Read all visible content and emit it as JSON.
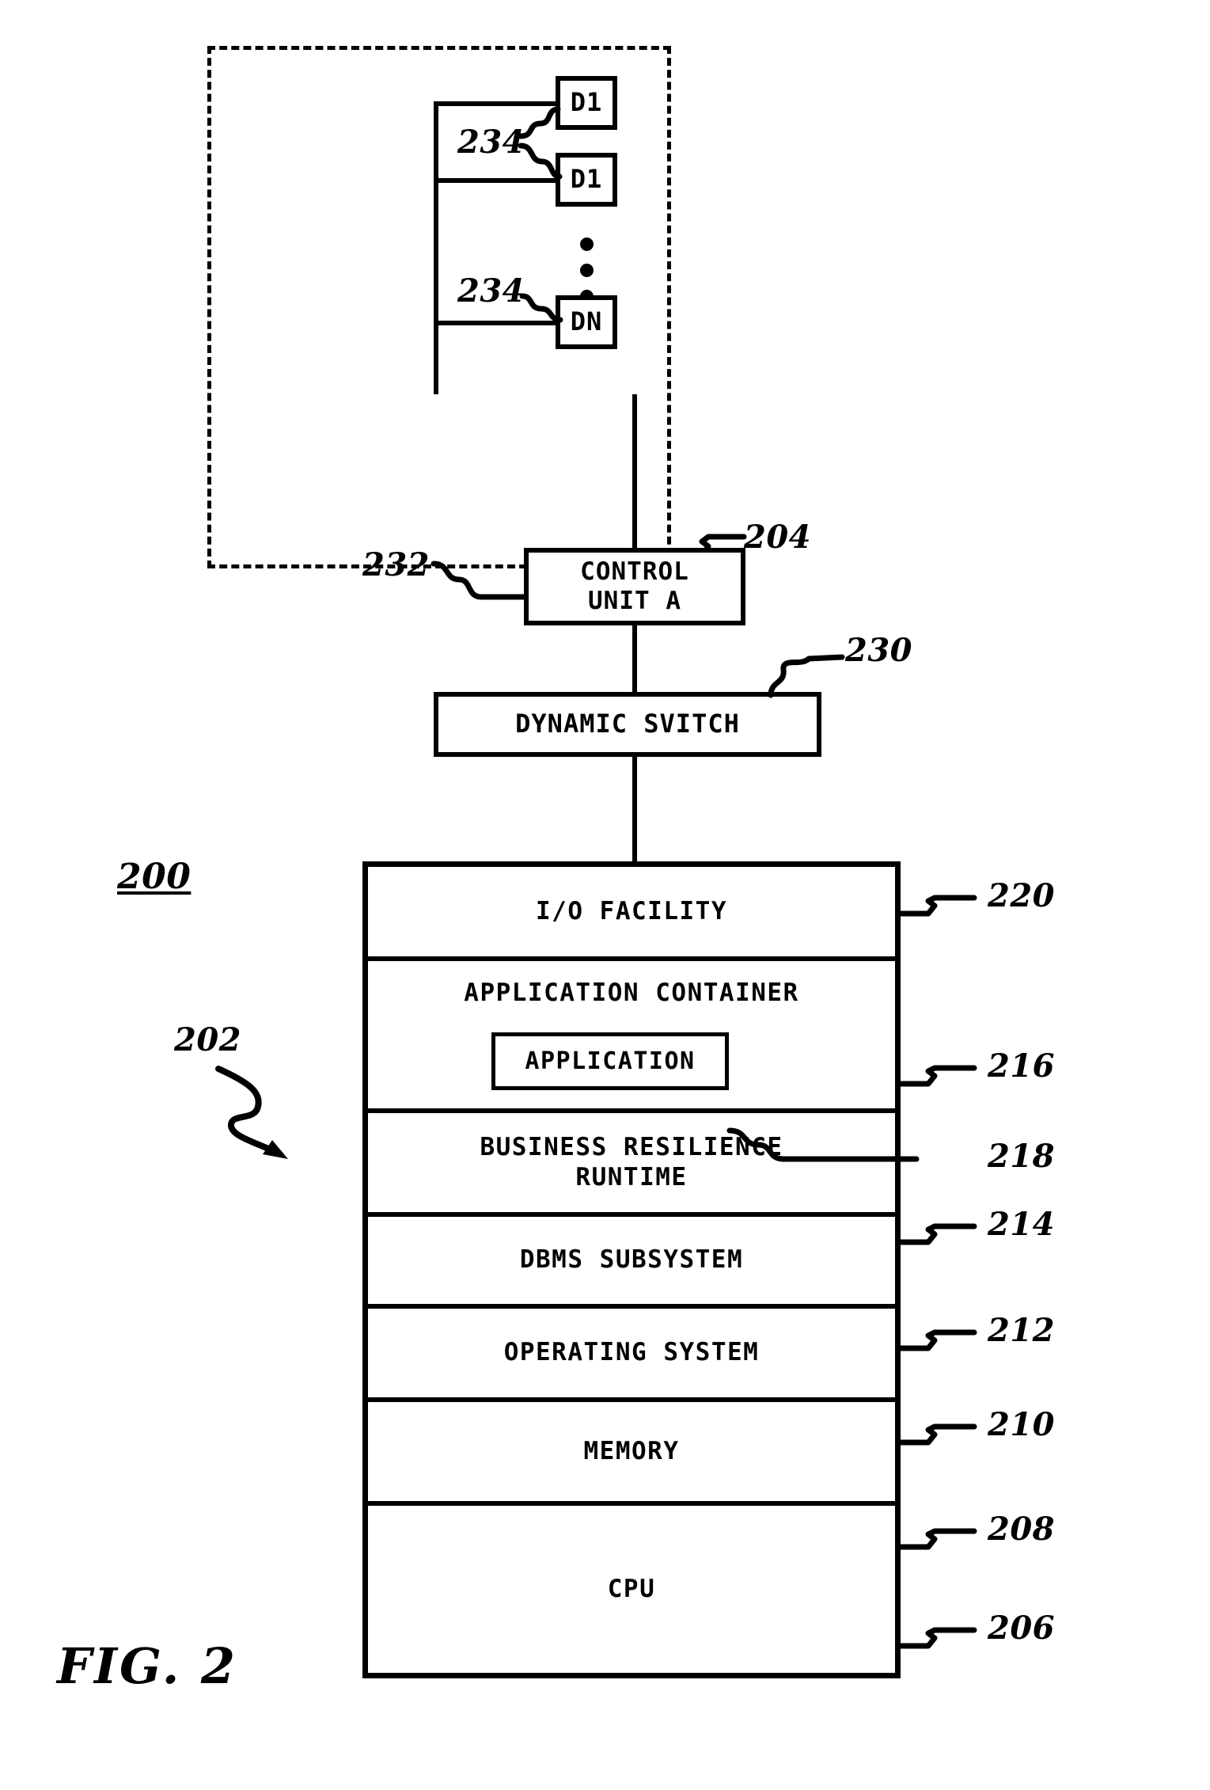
{
  "figure": {
    "caption": "FIG. 2",
    "system_ref": "200",
    "host_ref": "202",
    "io_subsystem_ref": "204"
  },
  "io_subsystem": {
    "devices": [
      {
        "label": "D1",
        "ref": "234"
      },
      {
        "label": "D1",
        "ref": "234"
      },
      {
        "label": "DN",
        "ref": "234"
      }
    ],
    "device_ellipsis": "vertical-dots",
    "control_unit": {
      "label": "CONTROL\nUNIT A",
      "line1": "CONTROL",
      "line2": "UNIT A",
      "ref": "232"
    },
    "dynamic_switch": {
      "label": "DYNAMIC SVITCH",
      "ref": "230"
    },
    "device_leader_ref_top": "234",
    "device_leader_ref_bottom": "234"
  },
  "stack": {
    "rows": [
      {
        "label": "I/O FACILITY",
        "ref": "220"
      },
      {
        "label": "APPLICATION CONTAINER",
        "ref": "216",
        "inner": {
          "label": "APPLICATION",
          "ref": "218"
        }
      },
      {
        "label": "BUSINESS RESILIENCE RUNTIME",
        "line1": "BUSINESS RESILIENCE",
        "line2": "RUNTIME",
        "ref": "214"
      },
      {
        "label": "DBMS SUBSYSTEM",
        "ref": "212"
      },
      {
        "label": "OPERATING SYSTEM",
        "ref": "210"
      },
      {
        "label": "MEMORY",
        "ref": "208"
      },
      {
        "label": "CPU",
        "ref": "206"
      }
    ]
  },
  "colors": {
    "ink": "#000000",
    "paper": "#ffffff"
  }
}
